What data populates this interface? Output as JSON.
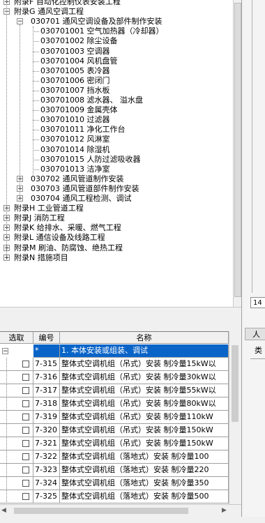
{
  "tree": {
    "items": [
      {
        "label": "附录F 自动化控制仪表安装工程",
        "level": 0,
        "toggle": "+"
      },
      {
        "label": "附录G 通风空调工程",
        "level": 0,
        "toggle": "-"
      },
      {
        "label": "030701 通风空调设备及部件制作安装",
        "level": 1,
        "toggle": "-"
      },
      {
        "label": "030701001 空气加热器（冷却器）",
        "level": 2
      },
      {
        "label": "030701002 除尘设备",
        "level": 2
      },
      {
        "label": "030701003 空调器",
        "level": 2
      },
      {
        "label": "030701004 风机盘管",
        "level": 2
      },
      {
        "label": "030701005 表冷器",
        "level": 2
      },
      {
        "label": "030701006 密闭门",
        "level": 2
      },
      {
        "label": "030701007 挡水板",
        "level": 2
      },
      {
        "label": "030701008 滤水器、 溢水盘",
        "level": 2
      },
      {
        "label": "030701009 金属壳体",
        "level": 2
      },
      {
        "label": "030701010 过滤器",
        "level": 2
      },
      {
        "label": "030701011 净化工作台",
        "level": 2
      },
      {
        "label": "030701012 风淋室",
        "level": 2
      },
      {
        "label": "030701014 除湿机",
        "level": 2
      },
      {
        "label": "030701015 人防过滤吸收器",
        "level": 2
      },
      {
        "label": "030701013 洁净室",
        "level": 2
      },
      {
        "label": "030702 通风管道制作安装",
        "level": 1,
        "toggle": "+"
      },
      {
        "label": "030703 通风管道部件制作安装",
        "level": 1,
        "toggle": "+"
      },
      {
        "label": "030704 通风工程检测、调试",
        "level": 1,
        "toggle": "+"
      },
      {
        "label": "附录H 工业管道工程",
        "level": 0,
        "toggle": "+"
      },
      {
        "label": "附录J 消防工程",
        "level": 0,
        "toggle": "+"
      },
      {
        "label": "附录K 给排水、采暖、燃气工程",
        "level": 0,
        "toggle": "+"
      },
      {
        "label": "附录L 通信设备及线路工程",
        "level": 0,
        "toggle": "+"
      },
      {
        "label": "附录M 刷油、防腐蚀、绝热工程",
        "level": 0,
        "toggle": "+"
      },
      {
        "label": "附录N 措施项目",
        "level": 0,
        "toggle": "+"
      }
    ]
  },
  "right": {
    "field_value": "14",
    "button_label": "人",
    "col_label": "类"
  },
  "grid": {
    "headers": {
      "select": "选取",
      "code": "编号",
      "name": "名称"
    },
    "group_row": {
      "code": "*",
      "name": "1. 本体安装或组装、调试"
    },
    "rows": [
      {
        "code": "7-315",
        "name": "整体式空调机组（吊式）安装   制冷量15kW以"
      },
      {
        "code": "7-316",
        "name": "整体式空调机组（吊式）安装   制冷量30kW以"
      },
      {
        "code": "7-317",
        "name": "整体式空调机组（吊式）安装   制冷量55kW以"
      },
      {
        "code": "7-318",
        "name": "整体式空调机组（吊式）安装   制冷量80kW以"
      },
      {
        "code": "7-319",
        "name": "整体式空调机组（吊式）安装   制冷量110kW"
      },
      {
        "code": "7-320",
        "name": "整体式空调机组（吊式）安装   制冷量150kW"
      },
      {
        "code": "7-321",
        "name": "整体式空调机组（吊式）安装   制冷量150kW"
      },
      {
        "code": "7-322",
        "name": "整体式空调机组（落地式）安装   制冷量100"
      },
      {
        "code": "7-323",
        "name": "整体式空调机组（落地式）安装   制冷量220"
      },
      {
        "code": "7-324",
        "name": "整体式空调机组（落地式）安装   制冷量350"
      },
      {
        "code": "7-325",
        "name": "整体式空调机组（落地式）安装   制冷量500"
      }
    ]
  },
  "colors": {
    "selection": "#0a64c8",
    "header_bg": "#f0f0f0"
  }
}
